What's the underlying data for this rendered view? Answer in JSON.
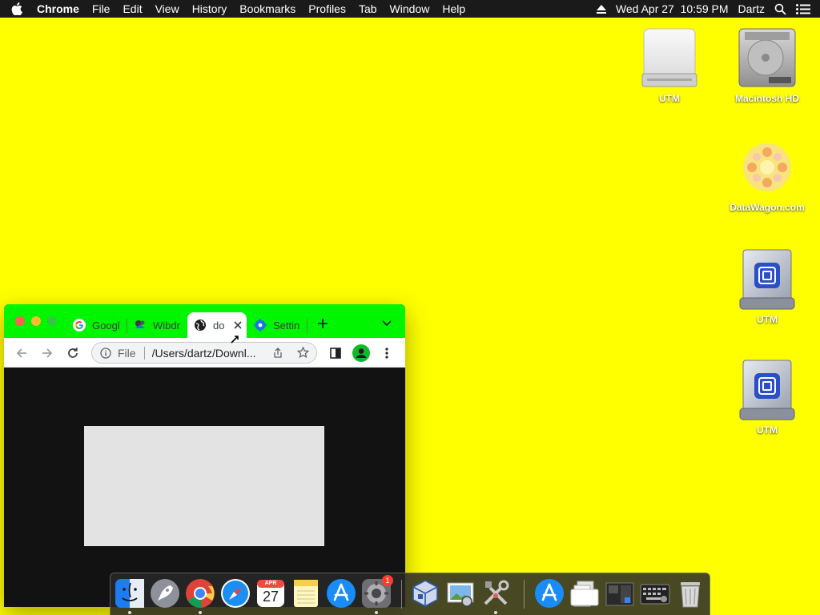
{
  "menubar": {
    "app_name": "Chrome",
    "menus": [
      "File",
      "Edit",
      "View",
      "History",
      "Bookmarks",
      "Profiles",
      "Tab",
      "Window",
      "Help"
    ],
    "datetime": "Wed Apr 27  10:59 PM",
    "user": "Dartz",
    "icons": [
      "apple-icon",
      "eject-icon",
      "search-icon",
      "control-center-icon"
    ]
  },
  "desktop": {
    "icons": [
      {
        "label": "UTM",
        "icon": "external-drive-icon"
      },
      {
        "label": "Macintosh HD",
        "icon": "hard-drive-icon"
      },
      {
        "label": "DataWagon.com",
        "icon": "datawagon-image-icon"
      },
      {
        "label": "UTM",
        "icon": "utm-disk-icon"
      },
      {
        "label": "UTM",
        "icon": "utm-disk-icon"
      }
    ]
  },
  "browser": {
    "tabs": [
      {
        "label": "Googl",
        "icon": "google-icon",
        "active": false
      },
      {
        "label": "Wibdr",
        "icon": "wibdr-icon",
        "active": false
      },
      {
        "label": "do",
        "icon": "globe-icon",
        "active": true
      },
      {
        "label": "Settin",
        "icon": "gear-icon",
        "active": false
      }
    ],
    "omnibox": {
      "scheme_label": "File",
      "url": "/Users/dartz/Downl..."
    },
    "colors": {
      "tab_strip": "#00f500",
      "content_bg": "#121212",
      "placeholder": "#e3e3e3"
    }
  },
  "dock": {
    "apps": [
      "Finder",
      "Launchpad",
      "Google Chrome",
      "Safari",
      "Calendar",
      "Notes",
      "App Store",
      "System Preferences",
      "VirtualBox",
      "Preview",
      "Utilities",
      "App Store Folder",
      "Documents",
      "Screenshot",
      "Keyboard Viewer",
      "Trash"
    ],
    "calendar": {
      "month": "APR",
      "day": "27"
    },
    "badge": "1"
  },
  "colors": {
    "desktop": "#ffff00"
  }
}
